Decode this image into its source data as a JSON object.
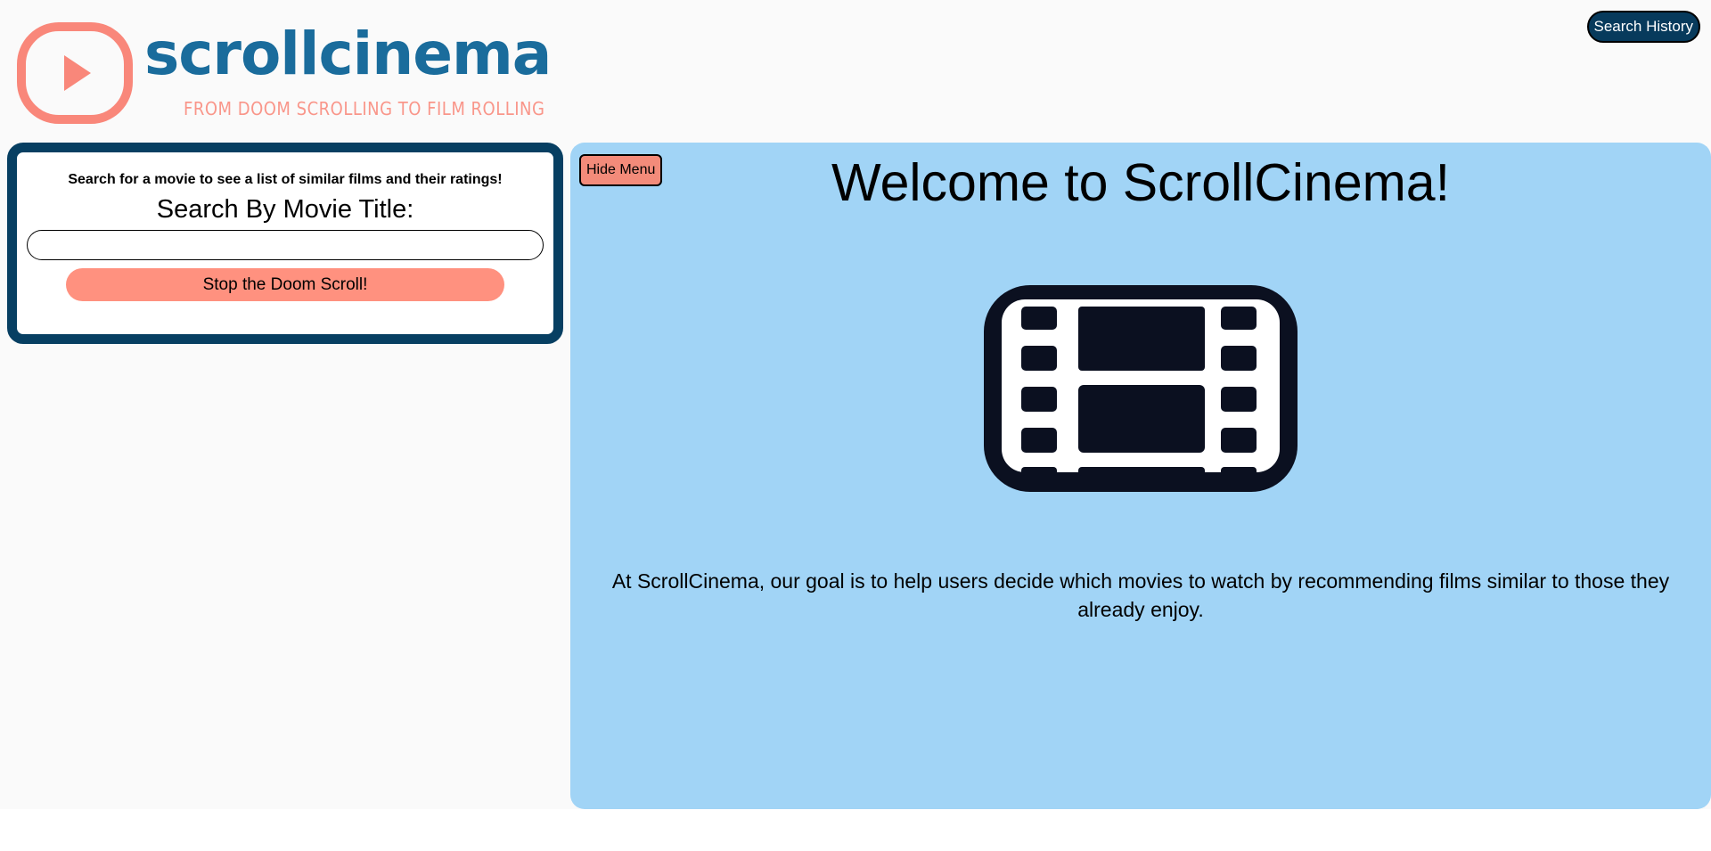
{
  "header": {
    "logo_wordmark": "scrollcinema",
    "logo_tagline": "FROM DOOM SCROLLING TO FILM ROLLING",
    "search_history_label": "Search History"
  },
  "search": {
    "hint": "Search for a movie to see a list of similar films and their ratings!",
    "title_label": "Search By Movie Title:",
    "input_value": "",
    "submit_label": "Stop the Doom Scroll!"
  },
  "main": {
    "hide_menu_label": "Hide Menu",
    "title": "Welcome to ScrollCinema!",
    "mission": "At ScrollCinema, our goal is to help users decide which movies to watch by recommending films similar to those they already enjoy."
  },
  "icons": {
    "logo": "play-icon",
    "hero": "film-strip-icon"
  },
  "colors": {
    "brand_blue": "#1a6c9c",
    "navy": "#073f62",
    "coral": "#ff917f",
    "panel_blue": "#a1d4f6"
  }
}
